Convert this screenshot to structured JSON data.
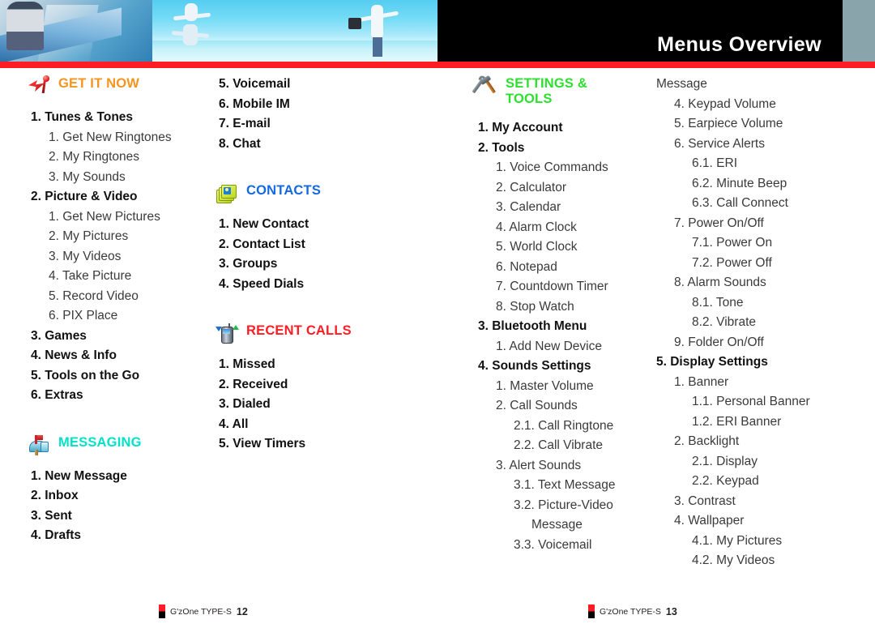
{
  "header": {
    "title": "Menus Overview",
    "accent_red": "#ff1d25",
    "band_black": "#000000",
    "band_gray": "#89a4ab"
  },
  "sections": {
    "get_it_now": {
      "title": "GET IT NOW",
      "icon": "red-arrow-flag-icon",
      "color": "#f7941d",
      "items": [
        {
          "level": 1,
          "text": "1. Tunes & Tones"
        },
        {
          "level": 2,
          "text": "1. Get New Ringtones"
        },
        {
          "level": 2,
          "text": "2. My Ringtones"
        },
        {
          "level": 2,
          "text": "3. My Sounds"
        },
        {
          "level": 1,
          "text": "2. Picture & Video"
        },
        {
          "level": 2,
          "text": "1. Get New Pictures"
        },
        {
          "level": 2,
          "text": "2. My Pictures"
        },
        {
          "level": 2,
          "text": "3. My Videos"
        },
        {
          "level": 2,
          "text": "4. Take Picture"
        },
        {
          "level": 2,
          "text": "5. Record Video"
        },
        {
          "level": 2,
          "text": "6. PIX Place"
        },
        {
          "level": 1,
          "text": "3. Games"
        },
        {
          "level": 1,
          "text": "4. News & Info"
        },
        {
          "level": 1,
          "text": "5. Tools on the Go"
        },
        {
          "level": 1,
          "text": "6. Extras"
        }
      ]
    },
    "messaging": {
      "title": "MESSAGING",
      "icon": "mailbox-icon",
      "color": "#00e2c8",
      "items": [
        {
          "level": 1,
          "text": "1. New Message"
        },
        {
          "level": 1,
          "text": "2. Inbox"
        },
        {
          "level": 1,
          "text": "3. Sent"
        },
        {
          "level": 1,
          "text": "4. Drafts"
        }
      ]
    },
    "messaging_continued": {
      "items": [
        {
          "level": 1,
          "text": "5. Voicemail"
        },
        {
          "level": 1,
          "text": "6. Mobile IM"
        },
        {
          "level": 1,
          "text": "7. E-mail"
        },
        {
          "level": 1,
          "text": "8. Chat"
        }
      ]
    },
    "contacts": {
      "title": "CONTACTS",
      "icon": "contact-cards-icon",
      "color": "#1569e0",
      "items": [
        {
          "level": 1,
          "text": "1. New Contact"
        },
        {
          "level": 1,
          "text": "2. Contact List"
        },
        {
          "level": 1,
          "text": "3. Groups"
        },
        {
          "level": 1,
          "text": "4. Speed Dials"
        }
      ]
    },
    "recent_calls": {
      "title": "RECENT CALLS",
      "icon": "phone-calls-icon",
      "color": "#ff1d25",
      "items": [
        {
          "level": 1,
          "text": "1. Missed"
        },
        {
          "level": 1,
          "text": "2. Received"
        },
        {
          "level": 1,
          "text": "3. Dialed"
        },
        {
          "level": 1,
          "text": "4. All"
        },
        {
          "level": 1,
          "text": "5. View Timers"
        }
      ]
    },
    "settings_tools": {
      "title": "SETTINGS &\nTOOLS",
      "icon": "wrench-hammer-icon",
      "color": "#2de02d",
      "items": [
        {
          "level": 1,
          "text": "1. My Account"
        },
        {
          "level": 1,
          "text": "2. Tools"
        },
        {
          "level": 2,
          "text": "1. Voice Commands"
        },
        {
          "level": 2,
          "text": "2. Calculator"
        },
        {
          "level": 2,
          "text": "3. Calendar"
        },
        {
          "level": 2,
          "text": "4. Alarm Clock"
        },
        {
          "level": 2,
          "text": "5. World Clock"
        },
        {
          "level": 2,
          "text": "6. Notepad"
        },
        {
          "level": 2,
          "text": "7. Countdown Timer"
        },
        {
          "level": 2,
          "text": "8. Stop Watch"
        },
        {
          "level": 1,
          "text": "3. Bluetooth Menu"
        },
        {
          "level": 2,
          "text": "1. Add New Device"
        },
        {
          "level": 1,
          "text": "4. Sounds Settings"
        },
        {
          "level": 2,
          "text": "1. Master Volume"
        },
        {
          "level": 2,
          "text": "2. Call Sounds"
        },
        {
          "level": 3,
          "text": "2.1. Call Ringtone"
        },
        {
          "level": 3,
          "text": "2.2. Call Vibrate"
        },
        {
          "level": 2,
          "text": "3. Alert Sounds"
        },
        {
          "level": 3,
          "text": "3.1. Text Message"
        },
        {
          "level": 3,
          "text": "3.2. Picture-Video"
        },
        {
          "level": 4,
          "text": "Message"
        },
        {
          "level": 3,
          "text": "3.3. Voicemail"
        }
      ]
    },
    "settings_tools_continued": {
      "items": [
        {
          "level": 0,
          "text": "Message"
        },
        {
          "level": 2,
          "text": "4. Keypad Volume"
        },
        {
          "level": 2,
          "text": "5. Earpiece Volume"
        },
        {
          "level": 2,
          "text": "6. Service Alerts"
        },
        {
          "level": 3,
          "text": "6.1. ERI"
        },
        {
          "level": 3,
          "text": "6.2. Minute Beep"
        },
        {
          "level": 3,
          "text": "6.3. Call Connect"
        },
        {
          "level": 2,
          "text": "7. Power On/Off"
        },
        {
          "level": 3,
          "text": "7.1. Power On"
        },
        {
          "level": 3,
          "text": "7.2. Power Off"
        },
        {
          "level": 2,
          "text": "8. Alarm Sounds"
        },
        {
          "level": 3,
          "text": "8.1. Tone"
        },
        {
          "level": 3,
          "text": "8.2. Vibrate"
        },
        {
          "level": 2,
          "text": "9. Folder On/Off"
        },
        {
          "level": 1,
          "text": "5. Display Settings"
        },
        {
          "level": 2,
          "text": "1. Banner"
        },
        {
          "level": 3,
          "text": "1.1. Personal Banner"
        },
        {
          "level": 3,
          "text": "1.2. ERI Banner"
        },
        {
          "level": 2,
          "text": "2. Backlight"
        },
        {
          "level": 3,
          "text": "2.1. Display"
        },
        {
          "level": 3,
          "text": "2.2. Keypad"
        },
        {
          "level": 2,
          "text": "3. Contrast"
        },
        {
          "level": 2,
          "text": "4. Wallpaper"
        },
        {
          "level": 3,
          "text": "4.1. My Pictures"
        },
        {
          "level": 3,
          "text": "4.2. My Videos"
        }
      ]
    }
  },
  "footers": {
    "left": {
      "label": "G'zOne TYPE-S",
      "page": "12"
    },
    "right": {
      "label": "G'zOne TYPE-S",
      "page": "13"
    }
  }
}
